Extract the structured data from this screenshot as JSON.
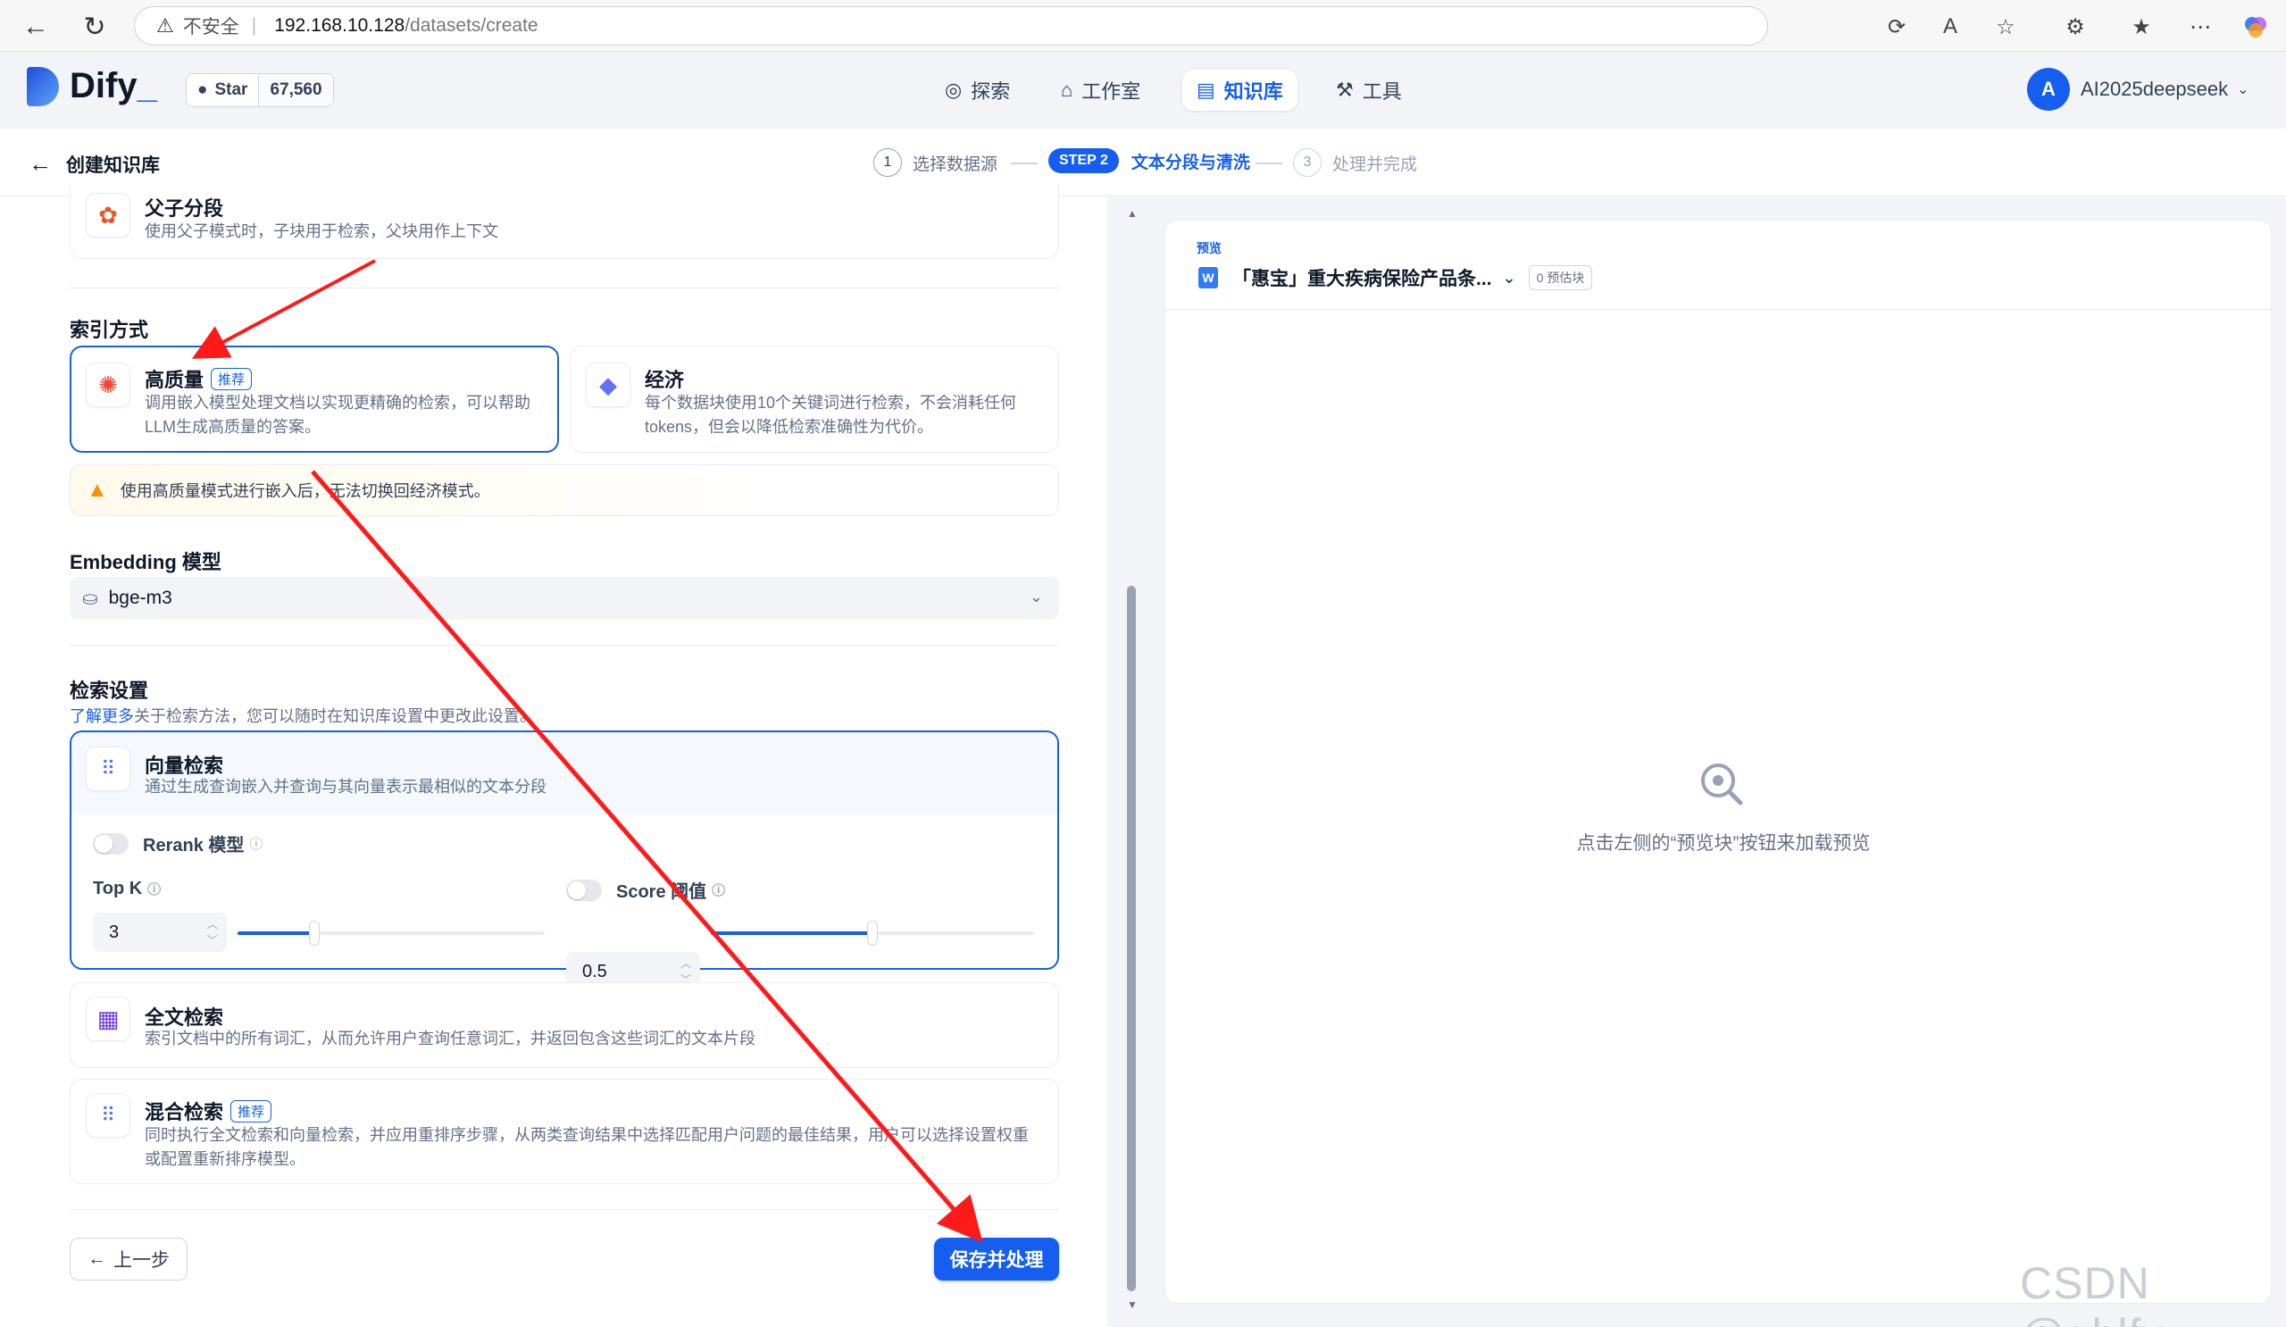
{
  "browser": {
    "insecure_label": "不安全",
    "url_host": "192.168.10.128",
    "url_path": "/datasets/create"
  },
  "app": {
    "logo_text": "Dify",
    "github_star_label": "Star",
    "github_star_count": "67,560",
    "nav": [
      {
        "label": "探索"
      },
      {
        "label": "工作室"
      },
      {
        "label": "知识库"
      },
      {
        "label": "工具"
      }
    ],
    "user_initial": "A",
    "user_name": "AI2025deepseek"
  },
  "stepbar": {
    "back_label": "创建知识库",
    "steps": [
      {
        "num": "1",
        "label": "选择数据源"
      },
      {
        "badge": "STEP 2",
        "label": "文本分段与清洗"
      },
      {
        "num": "3",
        "label": "处理并完成"
      }
    ]
  },
  "chunk": {
    "parent_child_title": "父子分段",
    "parent_child_desc": "使用父子模式时，子块用于检索，父块用作上下文"
  },
  "index": {
    "section_title": "索引方式",
    "high_quality_title": "高质量",
    "high_quality_tag": "推荐",
    "high_quality_desc": "调用嵌入模型处理文档以实现更精确的检索，可以帮助LLM生成高质量的答案。",
    "economy_title": "经济",
    "economy_desc": "每个数据块使用10个关键词进行检索，不会消耗任何 tokens，但会以降低检索准确性为代价。",
    "warning": "使用高质量模式进行嵌入后，无法切换回经济模式。"
  },
  "embedding": {
    "section_title": "Embedding 模型",
    "model": "bge-m3"
  },
  "retrieval": {
    "section_title": "检索设置",
    "learn_more": "了解更多",
    "desc_rest": "关于检索方法，您可以随时在知识库设置中更改此设置。",
    "vector_title": "向量检索",
    "vector_desc": "通过生成查询嵌入并查询与其向量表示最相似的文本分段",
    "rerank_label": "Rerank 模型",
    "topk_label": "Top K",
    "topk_value": "3",
    "topk_fraction": 0.25,
    "score_label": "Score 阈值",
    "score_value": "0.5",
    "score_fraction": 0.5,
    "fulltext_title": "全文检索",
    "fulltext_desc": "索引文档中的所有词汇，从而允许用户查询任意词汇，并返回包含这些词汇的文本片段",
    "hybrid_title": "混合检索",
    "hybrid_tag": "推荐",
    "hybrid_desc": "同时执行全文检索和向量检索，并应用重排序步骤，从两类查询结果中选择匹配用户问题的最佳结果，用户可以选择设置权重或配置重新排序模型。"
  },
  "actions": {
    "prev_label": "上一步",
    "save_label": "保存并处理"
  },
  "preview": {
    "label": "预览",
    "file_name": "「惠宝」重大疾病保险产品条...",
    "estimate": "0 预估块",
    "empty_text": "点击左侧的“预览块”按钮来加载预览"
  },
  "watermark": "CSDN @gblfy",
  "colors": {
    "accent": "#155eef",
    "warning": "#f79009",
    "annotation_arrow": "#ff1a1a"
  }
}
